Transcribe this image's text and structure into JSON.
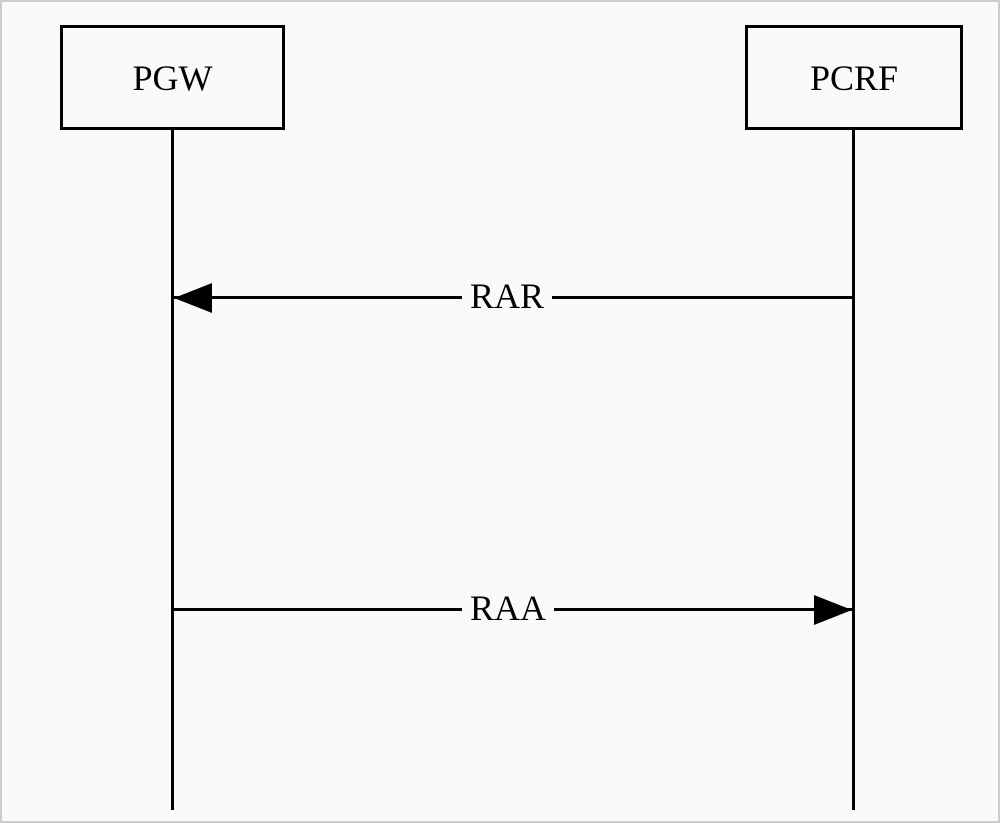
{
  "chart_data": {
    "type": "sequence-diagram",
    "participants": [
      {
        "name": "PGW",
        "position": "left"
      },
      {
        "name": "PCRF",
        "position": "right"
      }
    ],
    "messages": [
      {
        "from": "PCRF",
        "to": "PGW",
        "label": "RAR",
        "direction": "left"
      },
      {
        "from": "PGW",
        "to": "PCRF",
        "label": "RAA",
        "direction": "right"
      }
    ]
  },
  "participants": {
    "pgw": "PGW",
    "pcrf": "PCRF"
  },
  "messages": {
    "rar": "RAR",
    "raa": "RAA"
  }
}
